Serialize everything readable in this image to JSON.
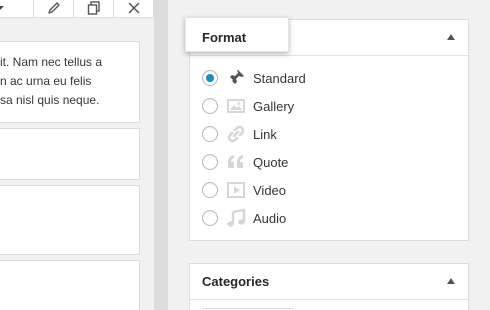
{
  "editor": {
    "toolbar": {
      "dropdown_icon": "chevron-down-icon",
      "edit_icon": "pencil-icon",
      "duplicate_icon": "duplicate-icon",
      "close_icon": "close-icon"
    },
    "paragraph_lines": [
      "it. Nam nec tellus a",
      "n ac urna eu felis",
      "sa nisl quis neque."
    ]
  },
  "format_box": {
    "title": "Format",
    "options": [
      {
        "label": "Standard",
        "icon": "pin-icon",
        "selected": true
      },
      {
        "label": "Gallery",
        "icon": "gallery-icon",
        "selected": false
      },
      {
        "label": "Link",
        "icon": "link-icon",
        "selected": false
      },
      {
        "label": "Quote",
        "icon": "quote-icon",
        "selected": false
      },
      {
        "label": "Video",
        "icon": "video-icon",
        "selected": false
      },
      {
        "label": "Audio",
        "icon": "audio-icon",
        "selected": false
      }
    ]
  },
  "categories_box": {
    "title": "Categories"
  },
  "colors": {
    "accent": "#1e8cbe",
    "icon_muted": "#d6d6d6",
    "icon_active": "#555555"
  }
}
